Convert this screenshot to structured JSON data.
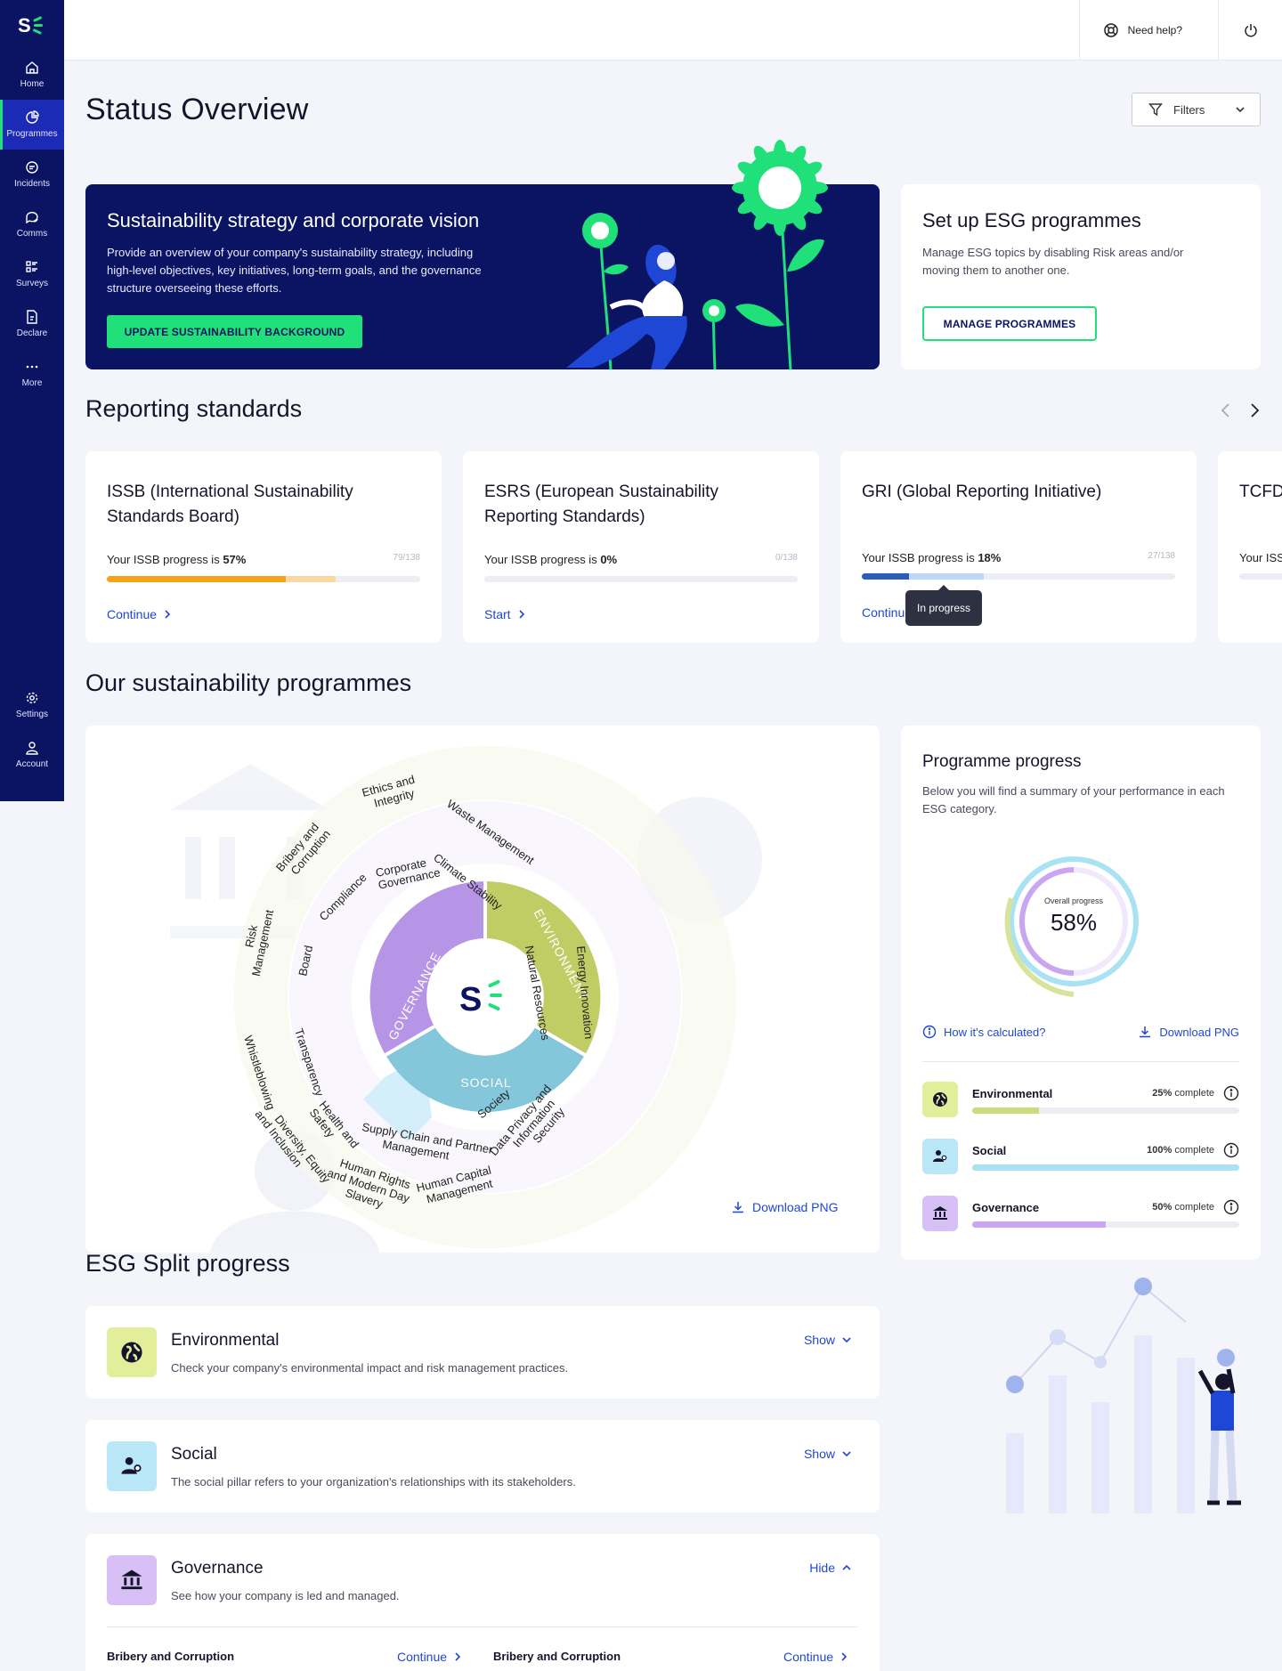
{
  "brand": {
    "accent": "#20e07a",
    "navy": "#0b1463",
    "link": "#1f47d6"
  },
  "sidebar": {
    "items": [
      {
        "label": "Home",
        "icon": "home-icon"
      },
      {
        "label": "Programmes",
        "icon": "pie-chart-icon",
        "active": true
      },
      {
        "label": "Incidents",
        "icon": "message-icon"
      },
      {
        "label": "Comms",
        "icon": "chat-icon"
      },
      {
        "label": "Surveys",
        "icon": "survey-icon"
      },
      {
        "label": "Declare",
        "icon": "declare-icon"
      },
      {
        "label": "More",
        "icon": "more-icon"
      }
    ],
    "bottom": [
      {
        "label": "Settings",
        "icon": "gear-icon"
      },
      {
        "label": "Account",
        "icon": "user-icon"
      }
    ]
  },
  "topbar": {
    "help": "Need help?"
  },
  "page": {
    "title": "Status Overview",
    "filters": "Filters"
  },
  "hero": {
    "title": "Sustainability strategy and corporate vision",
    "body": "Provide an overview of your company's sustainability strategy, including high-level objectives, key initiatives, long-term goals, and the governance structure overseeing these efforts.",
    "button": "UPDATE SUSTAINABILITY BACKGROUND"
  },
  "setup": {
    "title": "Set up ESG programmes",
    "body": "Manage ESG topics by disabling Risk areas and/or moving them to another one.",
    "button": "MANAGE PROGRAMMES"
  },
  "reporting": {
    "title": "Reporting standards",
    "cards": [
      {
        "title": "ISSB (International Sustainability Standards Board)",
        "progress_prefix": "Your ISSB progress is ",
        "progress": "57%",
        "count": "79/138",
        "link": "Continue",
        "fill": 0.57,
        "fill2": 0.16,
        "c1": "#f7a21b",
        "c2": "#fbd8a3"
      },
      {
        "title": "ESRS (European Sustainability Reporting Standards)",
        "progress_prefix": "Your ISSB progress is ",
        "progress": "0%",
        "count": "0/138",
        "link": "Start",
        "fill": 0,
        "fill2": 0,
        "c1": "#f7a21b",
        "c2": "#fbd8a3"
      },
      {
        "title": "GRI (Global Reporting Initiative)",
        "progress_prefix": "Your ISSB progress is ",
        "progress": "18%",
        "count": "27/138",
        "link": "Continue",
        "fill": 0.15,
        "fill2": 0.24,
        "c1": "#2a5cb8",
        "c2": "#bfd6f5"
      },
      {
        "title": "TCFD",
        "progress_prefix": "Your ISS",
        "progress": "",
        "count": "",
        "link": "",
        "fill": 0,
        "fill2": 0,
        "c1": "#2a5cb8",
        "c2": "#bfd6f5"
      }
    ],
    "tooltip": "In progress"
  },
  "programmes": {
    "title": "Our sustainability programmes",
    "download": "Download PNG",
    "wheel": {
      "pillars": [
        "GOVERNANCE",
        "ENVIRONMENT",
        "SOCIAL"
      ],
      "topics": [
        "Ethics and Integrity",
        "Waste Management",
        "Bribery and Corruption",
        "Corporate Governance",
        "Climate Stability",
        "Compliance",
        "Risk Management",
        "Board",
        "Natural Resources",
        "Energy Innovation",
        "Whistleblowing",
        "Transparency",
        "Health and Safety",
        "Supply Chain and Partner Management",
        "Society",
        "Diversity, Equity and Inclusion",
        "Data Privacy and Information Security",
        "Human Rights and Modern Day Slavery",
        "Human Capital Management"
      ]
    }
  },
  "progress": {
    "title": "Programme progress",
    "body": "Below you will find a summary of your performance in each ESG category.",
    "overall_label": "Overall progress",
    "overall": "58%",
    "calc": "How it's calculated?",
    "download": "Download PNG",
    "rows": [
      {
        "name": "Environmental",
        "pct": "25%",
        "suffix": " complete",
        "value": 0.25,
        "color": "#c9dc7e",
        "bg": "#e3ee9b",
        "icon": "globe-icon"
      },
      {
        "name": "Social",
        "pct": "100%",
        "suffix": " complete",
        "value": 1.0,
        "color": "#a9e2f3",
        "bg": "#b9e7f7",
        "icon": "people-icon"
      },
      {
        "name": "Governance",
        "pct": "50%",
        "suffix": " complete",
        "value": 0.5,
        "color": "#c9a6ef",
        "bg": "#d8bff5",
        "icon": "bank-icon"
      }
    ]
  },
  "split": {
    "title": "ESG Split progress",
    "rows": [
      {
        "name": "Environmental",
        "desc": "Check your company's environmental impact and risk management practices.",
        "toggle": "Show",
        "bg": "#e3ee9b",
        "icon": "globe-icon"
      },
      {
        "name": "Social",
        "desc": "The social pillar refers to your organization's relationships with its stakeholders.",
        "toggle": "Show",
        "bg": "#b9e7f7",
        "icon": "people-icon"
      },
      {
        "name": "Governance",
        "desc": "See how your company is led and managed.",
        "toggle": "Hide",
        "bg": "#d8bff5",
        "icon": "bank-icon"
      }
    ],
    "sub": [
      {
        "name": "Bribery and Corruption",
        "link": "Continue"
      },
      {
        "name": "Bribery and Corruption",
        "link": "Continue"
      }
    ]
  }
}
